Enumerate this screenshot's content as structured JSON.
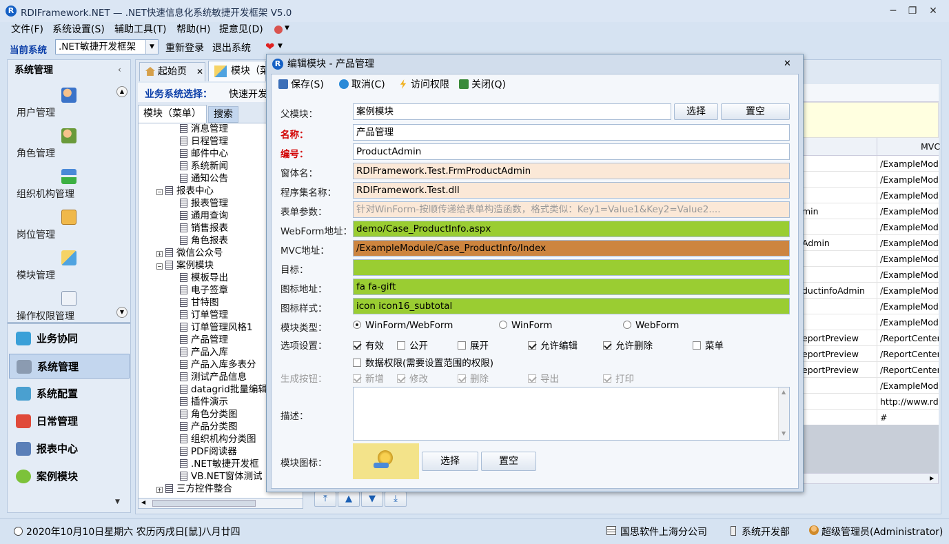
{
  "window": {
    "app_name": "RDIFramework.NET",
    "title": "RDIFramework.NET — .NET快速信息化系统敏捷开发框架 V5.0"
  },
  "menu": [
    "文件(F)",
    "系统设置(S)",
    "辅助工具(T)",
    "帮助(H)",
    "提意见(D)"
  ],
  "toolbar": {
    "current_system_label": "当前系统",
    "current_system_value": ".NET敏捷开发框架",
    "relogin": "重新登录",
    "logout": "退出系统"
  },
  "sidebar": {
    "title": "系统管理",
    "items": [
      "用户管理",
      "角色管理",
      "组织机构管理",
      "岗位管理",
      "模块管理",
      "操作权限管理"
    ],
    "nav": [
      "业务协同",
      "系统管理",
      "系统配置",
      "日常管理",
      "报表中心",
      "案例模块"
    ]
  },
  "tabs": [
    "起始页",
    "模块（菜"
  ],
  "business": {
    "label": "业务系统选择：",
    "value": "快速开发"
  },
  "subtabs": [
    "模块（菜单）",
    "搜索"
  ],
  "tree": [
    {
      "label": "消息管理",
      "level": 2
    },
    {
      "label": "日程管理",
      "level": 2
    },
    {
      "label": "邮件中心",
      "level": 2
    },
    {
      "label": "系统新闻",
      "level": 2
    },
    {
      "label": "通知公告",
      "level": 2
    },
    {
      "label": "报表中心",
      "level": 1,
      "toggle": "−"
    },
    {
      "label": "报表管理",
      "level": 2
    },
    {
      "label": "通用查询",
      "level": 2
    },
    {
      "label": "销售报表",
      "level": 2
    },
    {
      "label": "角色报表",
      "level": 2
    },
    {
      "label": "微信公众号",
      "level": 1,
      "toggle": "+"
    },
    {
      "label": "案例模块",
      "level": 1,
      "toggle": "−"
    },
    {
      "label": "模板导出",
      "level": 2
    },
    {
      "label": "电子签章",
      "level": 2
    },
    {
      "label": "甘特图",
      "level": 2
    },
    {
      "label": "订单管理",
      "level": 2
    },
    {
      "label": "订单管理风格1",
      "level": 2
    },
    {
      "label": "产品管理",
      "level": 2
    },
    {
      "label": "产品入库",
      "level": 2
    },
    {
      "label": "产品入库多表分",
      "level": 2
    },
    {
      "label": "测试产品信息",
      "level": 2
    },
    {
      "label": "datagrid批量编辑",
      "level": 2
    },
    {
      "label": "插件演示",
      "level": 2
    },
    {
      "label": "角色分类图",
      "level": 2
    },
    {
      "label": "产品分类图",
      "level": 2
    },
    {
      "label": "组织机构分类图",
      "level": 2
    },
    {
      "label": "PDF阅读器",
      "level": 2
    },
    {
      "label": ".NET敏捷开发框",
      "level": 2
    },
    {
      "label": "VB.NET窗体测试",
      "level": 2
    },
    {
      "label": "三方控件整合",
      "level": 1,
      "toggle": "+"
    }
  ],
  "grid": {
    "col_header": "MVC",
    "rows": [
      [
        "",
        "/ExampleModu"
      ],
      [
        "",
        "/ExampleModu"
      ],
      [
        "",
        "/ExampleModu"
      ],
      [
        "min",
        "/ExampleModu"
      ],
      [
        "",
        "/ExampleModu"
      ],
      [
        "Admin",
        "/ExampleModu"
      ],
      [
        "",
        "/ExampleModu"
      ],
      [
        "",
        "/ExampleModu"
      ],
      [
        "ductinfoAdmin",
        "/ExampleModu"
      ],
      [
        "",
        "/ExampleModu"
      ],
      [
        "",
        "/ExampleModu"
      ],
      [
        "eportPreview",
        "/ReportCenter/"
      ],
      [
        "eportPreview",
        "/ReportCenter/"
      ],
      [
        "eportPreview",
        "/ReportCenter/"
      ],
      [
        "",
        "/ExampleModu"
      ],
      [
        "",
        "http://www.rd"
      ],
      [
        "",
        "#"
      ]
    ]
  },
  "dialog": {
    "title": "编辑模块 - 产品管理",
    "toolbar": [
      "保存(S)",
      "取消(C)",
      "访问权限",
      "关闭(Q)"
    ],
    "fields": [
      {
        "label": "父模块：",
        "value": "案例模块"
      },
      {
        "label": "名称：",
        "value": "产品管理"
      },
      {
        "label": "编号：",
        "value": "ProductAdmin"
      },
      {
        "label": "窗体名：",
        "value": "RDIFramework.Test.FrmProductAdmin"
      },
      {
        "label": "程序集名称：",
        "value": "RDIFramework.Test.dll"
      },
      {
        "label": "表单参数：",
        "value": "针对WinForm-按顺传递给表单构造函数，格式类似：Key1=Value1&Key2=Value2...."
      },
      {
        "label": "WebForm地址：",
        "value": "demo/Case_ProductInfo.aspx"
      },
      {
        "label": "MVC地址：",
        "value": "/ExampleModule/Case_ProductInfo/Index"
      },
      {
        "label": "目标：",
        "value": ""
      },
      {
        "label": "图标地址：",
        "value": "fa  fa-gift"
      },
      {
        "label": "图标样式：",
        "value": "icon icon16_subtotal"
      }
    ],
    "select_btn": "选择",
    "clear_btn": "置空",
    "module_type": {
      "label": "模块类型：",
      "options": [
        "WinForm/WebForm",
        "WinForm",
        "WebForm"
      ]
    },
    "options": {
      "label": "选项设置：",
      "items": [
        {
          "label": "有效",
          "checked": true
        },
        {
          "label": "公开",
          "checked": false
        },
        {
          "label": "展开",
          "checked": false
        },
        {
          "label": "允许编辑",
          "checked": true
        },
        {
          "label": "允许删除",
          "checked": true
        },
        {
          "label": "菜单",
          "checked": false
        }
      ],
      "data_perm": "数据权限(需要设置范围的权限)"
    },
    "gen_buttons": {
      "label": "生成按钮：",
      "items": [
        "新增",
        "修改",
        "删除",
        "导出",
        "打印"
      ]
    },
    "desc_label": "描述：",
    "icon_label": "模块图标："
  },
  "status": {
    "date": "2020年10月10日星期六 农历丙戌日[鼠]八月廿四",
    "company": "国思软件上海分公司",
    "dept": "系统开发部",
    "user": "超级管理员(Administrator)"
  }
}
